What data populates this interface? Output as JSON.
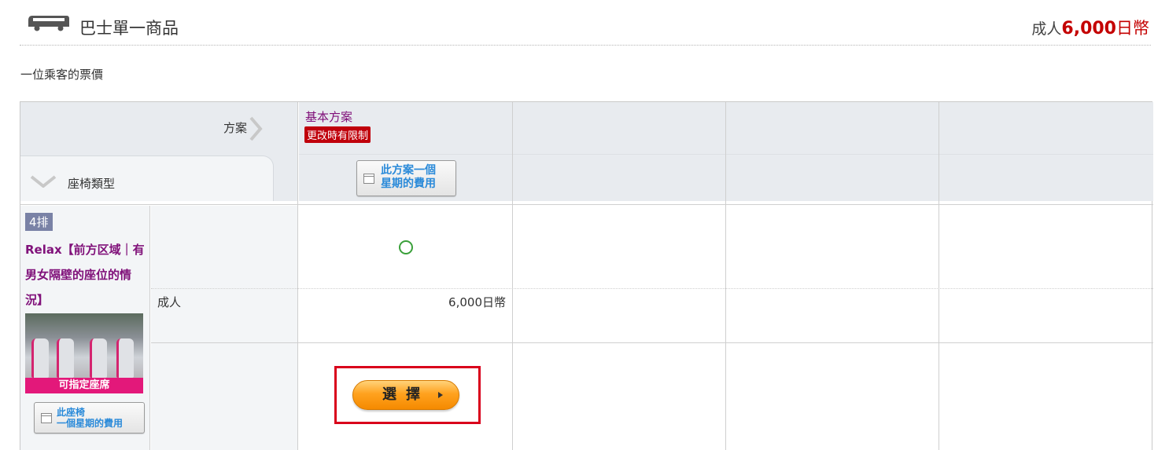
{
  "header": {
    "title": "巴士單一商品",
    "price_prefix": "成人",
    "price_value": "6,000",
    "price_unit": "日幣",
    "bus_icon": "bus-icon"
  },
  "subtitle": "一位乘客的票價",
  "table": {
    "plan_header": "方案",
    "seat_type_header": "座椅類型",
    "plans": [
      {
        "name": "基本方案",
        "badge": "更改時有限制",
        "week_button_line1": "此方案一個",
        "week_button_line2": "星期的費用"
      }
    ],
    "seat": {
      "row_badge": "4排",
      "name": "Relax【前方区域｜有男女隔壁的座位的情況】",
      "image_caption": "可指定座席",
      "week_button_line1": "此座椅",
      "week_button_line2": "一個星期的費用"
    },
    "passenger_label": "成人",
    "availability_symbol": "circle-available-icon",
    "fare": "6,000日幣",
    "select_button": "選擇"
  },
  "colors": {
    "accent_price": "#c40000",
    "plan_purple": "#80117a",
    "badge_red": "#c0000b",
    "select_orange": "#ffa21f",
    "highlight_red": "#d9001b"
  }
}
